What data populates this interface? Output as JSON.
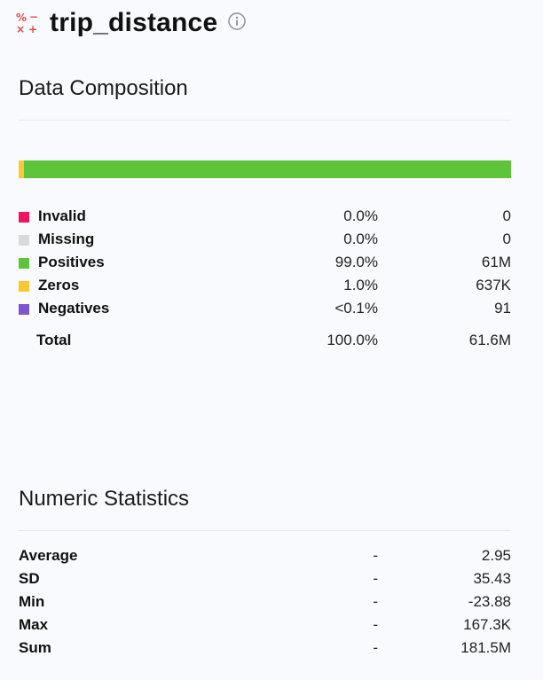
{
  "header": {
    "column_name": "trip_distance",
    "type_icon": "numeric-operators-icon",
    "info_icon": "info-circle-icon"
  },
  "composition": {
    "title": "Data Composition",
    "bar_fractions": {
      "zeros": 0.01,
      "positives": 0.99
    },
    "rows": [
      {
        "label": "Invalid",
        "pct": "0.0%",
        "count": "0",
        "color": "#f0135f"
      },
      {
        "label": "Missing",
        "pct": "0.0%",
        "count": "0",
        "color": "#d9dadb"
      },
      {
        "label": "Positives",
        "pct": "99.0%",
        "count": "61M",
        "color": "#5ec43b"
      },
      {
        "label": "Zeros",
        "pct": "1.0%",
        "count": "637K",
        "color": "#f8c934"
      },
      {
        "label": "Negatives",
        "pct": "<0.1%",
        "count": "91",
        "color": "#7b55d2"
      }
    ],
    "total": {
      "label": "Total",
      "pct": "100.0%",
      "count": "61.6M"
    }
  },
  "statistics": {
    "title": "Numeric Statistics",
    "rows": [
      {
        "label": "Average",
        "dash": "-",
        "value": "2.95"
      },
      {
        "label": "SD",
        "dash": "-",
        "value": "35.43"
      },
      {
        "label": "Min",
        "dash": "-",
        "value": "-23.88"
      },
      {
        "label": "Max",
        "dash": "-",
        "value": "167.3K"
      },
      {
        "label": "Sum",
        "dash": "-",
        "value": "181.5M"
      }
    ]
  }
}
